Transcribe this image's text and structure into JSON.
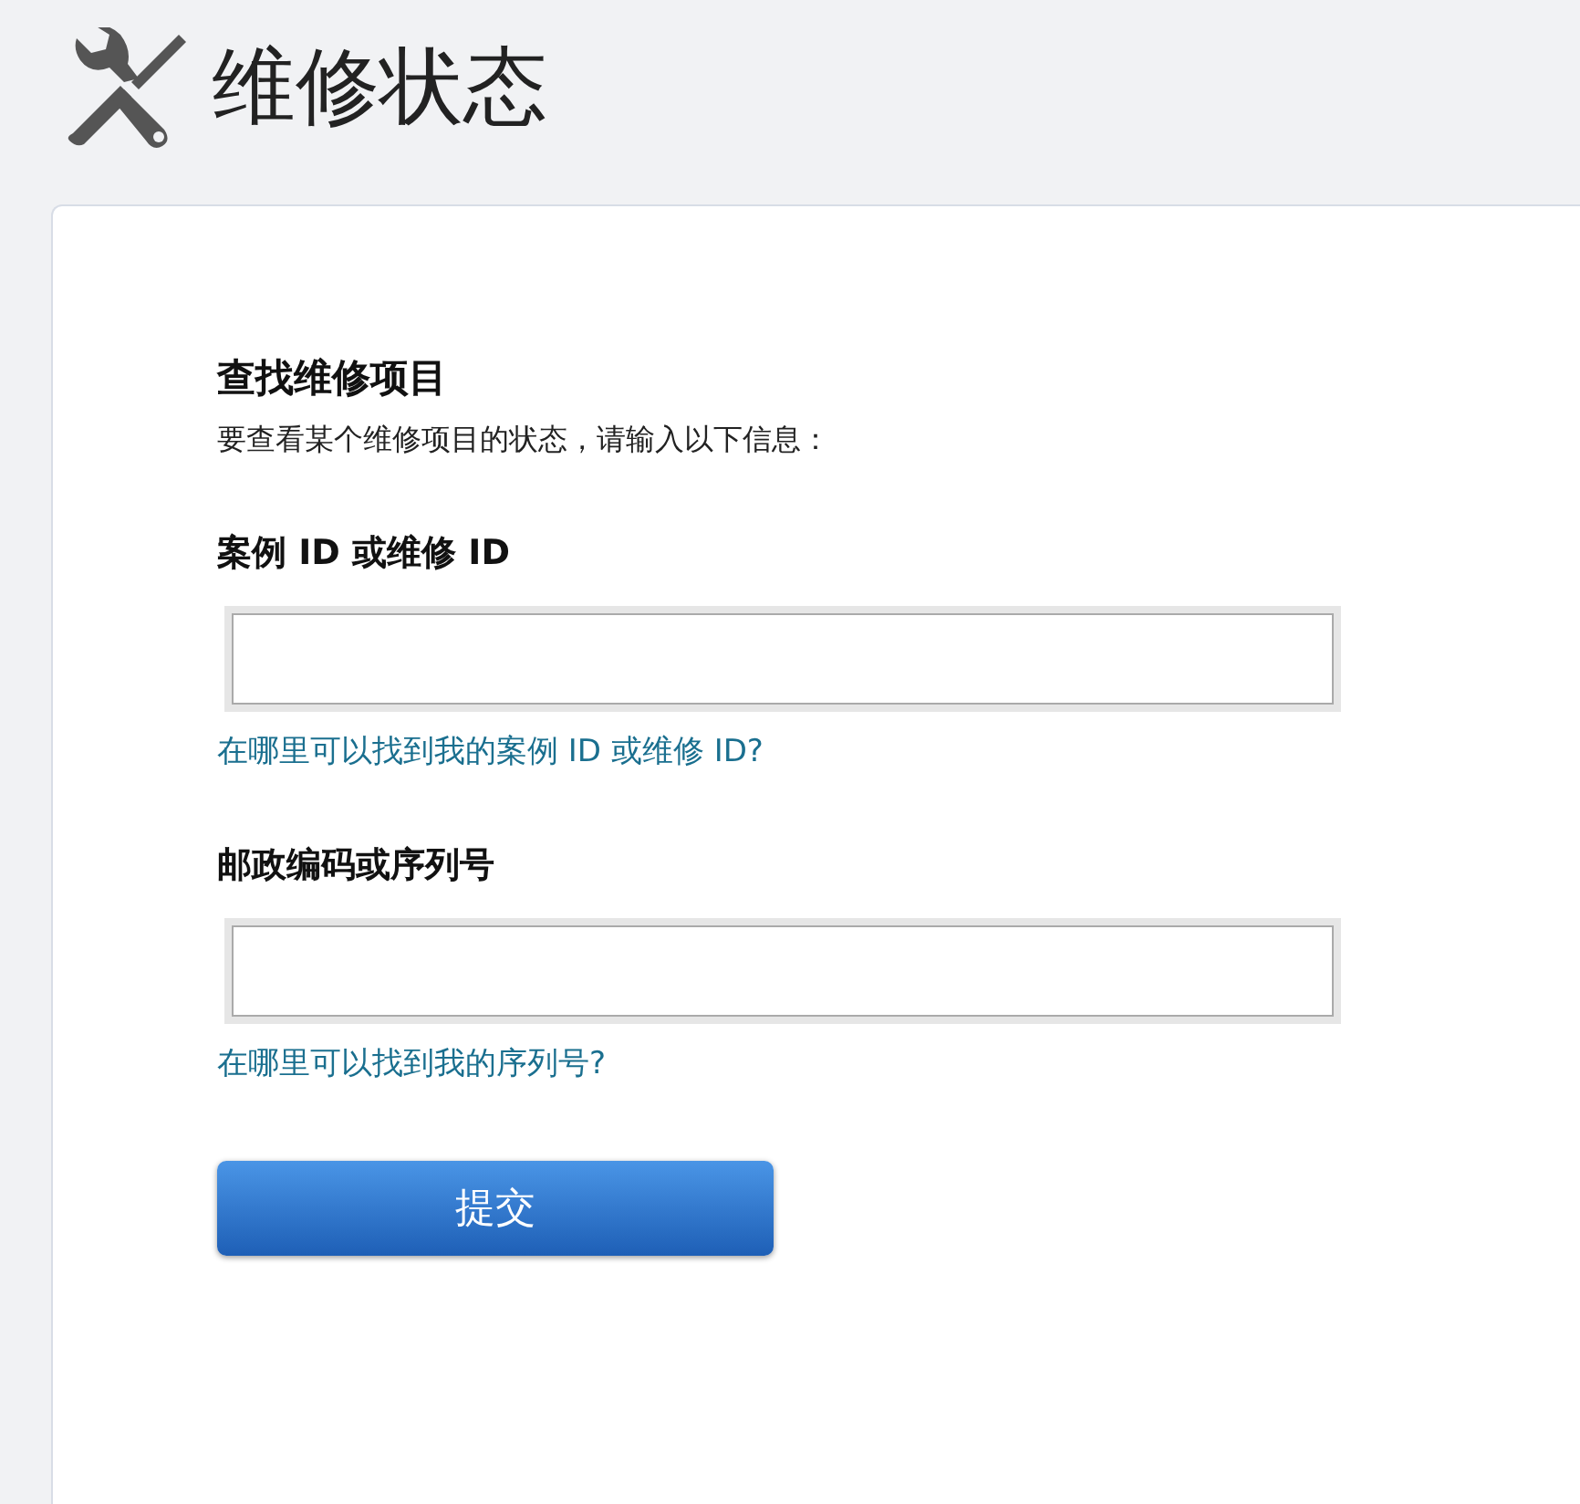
{
  "page": {
    "title": "维修状态"
  },
  "form": {
    "heading": "查找维修项目",
    "description": "要查看某个维修项目的状态，请输入以下信息：",
    "fields": [
      {
        "label": "案例 ID 或维修 ID",
        "help_link": "在哪里可以找到我的案例 ID 或维修 ID?"
      },
      {
        "label": "邮政编码或序列号",
        "help_link": "在哪里可以找到我的序列号?"
      }
    ],
    "submit": "提交"
  }
}
